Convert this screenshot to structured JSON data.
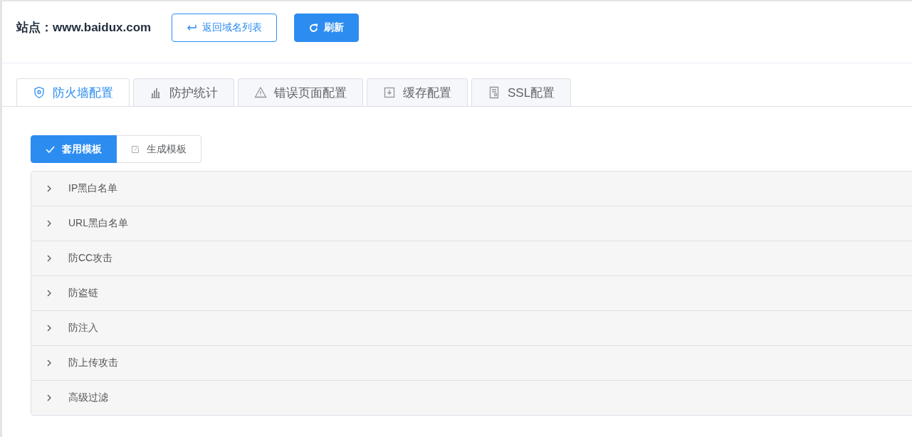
{
  "header": {
    "site_label": "站点：",
    "site": "www.baidux.com",
    "buttons": [
      {
        "label": "返回域名列表",
        "kind": "back"
      },
      {
        "label": "刷新",
        "kind": "refresh"
      }
    ]
  },
  "tabs": [
    {
      "label": "防火墙配置",
      "kind": "shield",
      "selected": true
    },
    {
      "label": "防护统计",
      "kind": "chart",
      "selected": false
    },
    {
      "label": "错误页面配置",
      "kind": "warning",
      "selected": false
    },
    {
      "label": "缓存配置",
      "kind": "download",
      "selected": false
    },
    {
      "label": "SSL配置",
      "kind": "cert",
      "selected": false
    }
  ],
  "template_buttons": [
    {
      "label": "套用模板",
      "kind": "check",
      "selected": true
    },
    {
      "label": "生成模板",
      "kind": "edit",
      "selected": false
    }
  ],
  "sections": [
    {
      "title": "IP黑白名单",
      "expanded": false
    },
    {
      "title": "URL黑白名单",
      "expanded": false
    },
    {
      "title": "防CC攻击",
      "expanded": false
    },
    {
      "title": "防盗链",
      "expanded": false
    },
    {
      "title": "防注入",
      "expanded": false
    },
    {
      "title": "防上传攻击",
      "expanded": false
    },
    {
      "title": "高级过滤",
      "expanded": false
    }
  ]
}
